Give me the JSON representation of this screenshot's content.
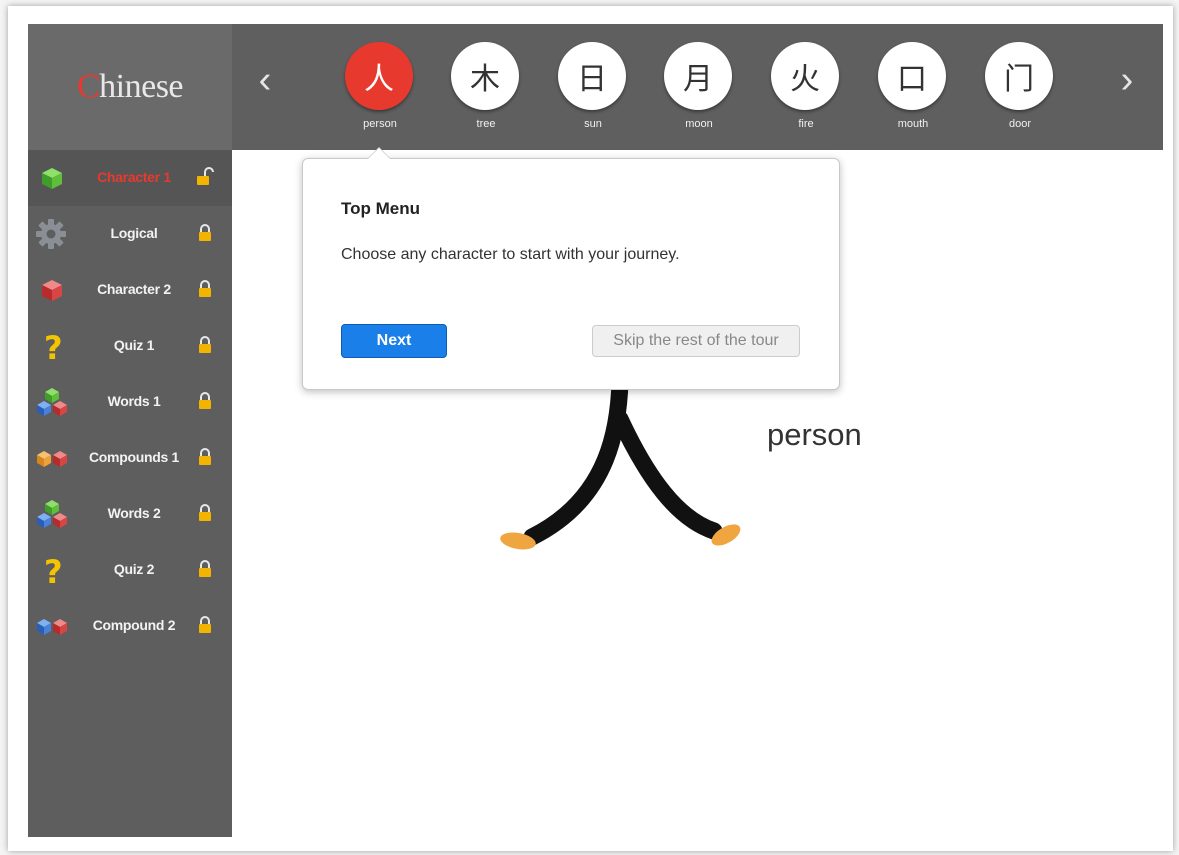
{
  "app": {
    "logo_first": "C",
    "logo_rest": "hinese"
  },
  "topbar": {
    "prev_arrow": "‹",
    "next_arrow": "›",
    "characters": [
      {
        "glyph": "人",
        "label": "person"
      },
      {
        "glyph": "木",
        "label": "tree"
      },
      {
        "glyph": "日",
        "label": "sun"
      },
      {
        "glyph": "月",
        "label": "moon"
      },
      {
        "glyph": "火",
        "label": "fire"
      },
      {
        "glyph": "口",
        "label": "mouth"
      },
      {
        "glyph": "门",
        "label": "door"
      }
    ]
  },
  "sidebar": {
    "items": [
      {
        "label": "Character 1",
        "icon": "green-cube-icon",
        "lock": "unlocked-padlock-icon"
      },
      {
        "label": "Logical",
        "icon": "gear-icon",
        "lock": "padlock-icon"
      },
      {
        "label": "Character 2",
        "icon": "red-cube-icon",
        "lock": "padlock-icon"
      },
      {
        "label": "Quiz 1",
        "icon": "question-mark-icon",
        "lock": "padlock-icon"
      },
      {
        "label": "Words 1",
        "icon": "cubes-stack-icon",
        "lock": "padlock-icon"
      },
      {
        "label": "Compounds 1",
        "icon": "cubes-pair-icon",
        "lock": "padlock-icon"
      },
      {
        "label": "Words 2",
        "icon": "cubes-stack-icon",
        "lock": "padlock-icon"
      },
      {
        "label": "Quiz 2",
        "icon": "question-mark-icon",
        "lock": "padlock-icon"
      },
      {
        "label": "Compound 2",
        "icon": "cubes-pair-icon",
        "lock": "padlock-icon"
      }
    ]
  },
  "main": {
    "character_word": "person"
  },
  "tour": {
    "title": "Top Menu",
    "text": "Choose any character to start with your journey.",
    "next_label": "Next",
    "skip_label": "Skip the rest of the tour"
  },
  "colors": {
    "accent_red": "#e8392f",
    "topbar_gray": "#5f5f5f",
    "sidebar_gray": "#5e5e5e",
    "next_blue": "#1a7fe8",
    "lock_yellow": "#f2b400",
    "foot_orange": "#f0a640"
  }
}
